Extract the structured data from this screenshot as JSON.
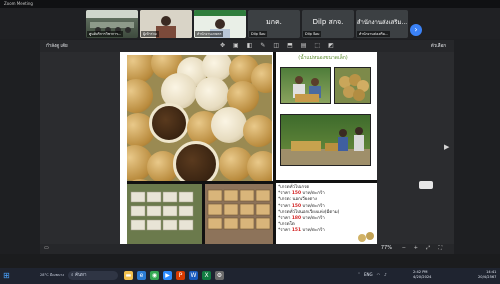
{
  "window": {
    "title": "Zoom Meeting"
  },
  "participants": [
    {
      "label": "ศูนย์บริการวิชาการ...",
      "kind": "video"
    },
    {
      "label": "ผู้เข้าร่วม",
      "kind": "video"
    },
    {
      "label": "สำนักงานเกษตร",
      "kind": "video"
    },
    {
      "label": "Dilp จ้อม",
      "kind": "name",
      "big": "มกค."
    },
    {
      "label": "Dilp จ้อม",
      "kind": "name",
      "big": "Dilp สกจ."
    },
    {
      "label": "สำนักงานส่งเสริม...",
      "kind": "name",
      "big": "สำนักงานส่งเสริม..."
    }
  ],
  "share": {
    "who": "กำลังดู เต้ย",
    "options": "ตัวเลือก",
    "tool_icons": [
      "✥",
      "▣",
      "◧",
      "✎",
      "◫",
      "⬒",
      "▤",
      "⬚",
      "◩"
    ]
  },
  "slide": {
    "title": "(น้ำแม่หนองขนาดเล็ก)",
    "info_lines": [
      {
        "label": "*เกรดทั่วไปเกรด",
        "red": ""
      },
      {
        "label": "*ราคา ",
        "red": "150",
        "tail": " บาท/ตะกร้า"
      },
      {
        "label": "*เกรด: นอกเวียงตาง",
        "red": ""
      },
      {
        "label": "*ราคา ",
        "red": "150",
        "tail": " บาท/ตะกร้า"
      },
      {
        "label": "*เกรดทั่วไปนอกเวียงแห่ง(มีตาม)",
        "red": ""
      },
      {
        "label": "*ราคา ",
        "red": "180",
        "tail": " บาท/ตะกร้า"
      },
      {
        "label": "*เกรดโต",
        "red": ""
      },
      {
        "label": "*ราคา ",
        "red": "151",
        "tail": " บาท/ตะกร้า"
      }
    ]
  },
  "viewer": {
    "zoom": "77%"
  },
  "taskbar": {
    "search_placeholder": "ค้นหา",
    "weather": "28°C มีเมฆบาง",
    "tray_lang": "ENG",
    "time": "14:41",
    "date": "20/4/2567",
    "time2": "2:42 PM",
    "date2": "4/20/2024"
  }
}
